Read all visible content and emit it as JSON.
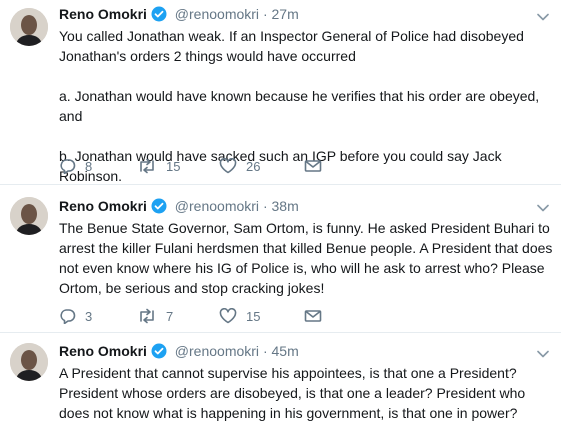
{
  "tweets": [
    {
      "name": "Reno Omokri",
      "handle": "@renoomokri",
      "time": "27m",
      "text": "You called Jonathan weak. If an Inspector General of Police had disobeyed Jonathan's orders 2 things would have occurred\n\na. Jonathan would have known because he verifies that his order are obeyed, and\n\nb. Jonathan would have sacked such an IGP before you could say Jack Robinson.",
      "replies": "8",
      "retweets": "15",
      "likes": "26"
    },
    {
      "name": "Reno Omokri",
      "handle": "@renoomokri",
      "time": "38m",
      "text": "The Benue State Governor, Sam Ortom, is funny. He asked President Buhari to arrest the killer Fulani herdsmen that killed Benue people. A President that does not even know where his IG of Police is, who will he ask to arrest who? Please Ortom, be serious and stop cracking jokes!",
      "replies": "3",
      "retweets": "7",
      "likes": "15"
    },
    {
      "name": "Reno Omokri",
      "handle": "@renoomokri",
      "time": "45m",
      "text": "A President that cannot supervise his appointees, is that one a President? President whose orders are disobeyed, is that one a leader? President who does not know what is happening in his government, is that one in power?"
    }
  ],
  "separator": "·",
  "colors": {
    "verified": "#1da1f2",
    "meta": "#657786",
    "text": "#14171a"
  }
}
